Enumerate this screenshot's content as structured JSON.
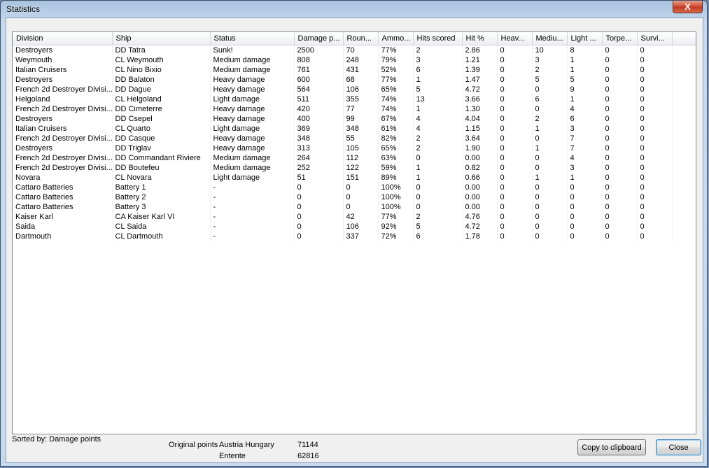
{
  "window": {
    "title": "Statistics",
    "close_glyph": "X"
  },
  "columns": [
    {
      "label": "Division",
      "w": 142
    },
    {
      "label": "Ship",
      "w": 140
    },
    {
      "label": "Status",
      "w": 120
    },
    {
      "label": "Damage p...",
      "w": 70
    },
    {
      "label": "Roun...",
      "w": 50
    },
    {
      "label": "Ammo...",
      "w": 50
    },
    {
      "label": "Hits scored",
      "w": 70
    },
    {
      "label": "Hit %",
      "w": 50
    },
    {
      "label": "Heav...",
      "w": 50
    },
    {
      "label": "Mediu...",
      "w": 50
    },
    {
      "label": "Light ...",
      "w": 50
    },
    {
      "label": "Torpe...",
      "w": 50
    },
    {
      "label": "Survi...",
      "w": 50
    },
    {
      "label": "",
      "w": 36
    }
  ],
  "rows": [
    [
      "Destroyers",
      "DD Tatra",
      "Sunk!",
      "2500",
      "70",
      "77%",
      "2",
      "2.86",
      "0",
      "10",
      "8",
      "0",
      "0"
    ],
    [
      "Weymouth",
      "CL Weymouth",
      "Medium damage",
      "808",
      "248",
      "79%",
      "3",
      "1.21",
      "0",
      "3",
      "1",
      "0",
      "0"
    ],
    [
      "Italian Cruisers",
      "CL Nino Bixio",
      "Medium damage",
      "761",
      "431",
      "52%",
      "6",
      "1.39",
      "0",
      "2",
      "1",
      "0",
      "0"
    ],
    [
      "Destroyers",
      "DD Balaton",
      "Heavy damage",
      "600",
      "68",
      "77%",
      "1",
      "1.47",
      "0",
      "5",
      "5",
      "0",
      "0"
    ],
    [
      "French 2d Destroyer Divisi...",
      "DD Dague",
      "Heavy damage",
      "564",
      "106",
      "65%",
      "5",
      "4.72",
      "0",
      "0",
      "9",
      "0",
      "0"
    ],
    [
      "Helgoland",
      "CL Helgoland",
      "Light damage",
      "511",
      "355",
      "74%",
      "13",
      "3.66",
      "0",
      "6",
      "1",
      "0",
      "0"
    ],
    [
      "French 2d Destroyer Divisi...",
      "DD Cimeterre",
      "Heavy damage",
      "420",
      "77",
      "74%",
      "1",
      "1.30",
      "0",
      "0",
      "4",
      "0",
      "0"
    ],
    [
      "Destroyers",
      "DD Csepel",
      "Heavy damage",
      "400",
      "99",
      "67%",
      "4",
      "4.04",
      "0",
      "2",
      "6",
      "0",
      "0"
    ],
    [
      "Italian Cruisers",
      "CL Quarto",
      "Light damage",
      "369",
      "348",
      "61%",
      "4",
      "1.15",
      "0",
      "1",
      "3",
      "0",
      "0"
    ],
    [
      "French 2d Destroyer Divisi...",
      "DD Casque",
      "Heavy damage",
      "348",
      "55",
      "82%",
      "2",
      "3.64",
      "0",
      "0",
      "7",
      "0",
      "0"
    ],
    [
      "Destroyers",
      "DD Triglav",
      "Heavy damage",
      "313",
      "105",
      "65%",
      "2",
      "1.90",
      "0",
      "1",
      "7",
      "0",
      "0"
    ],
    [
      "French 2d Destroyer Divisi...",
      "DD Commandant Riviere",
      "Medium damage",
      "264",
      "112",
      "63%",
      "0",
      "0.00",
      "0",
      "0",
      "4",
      "0",
      "0"
    ],
    [
      "French 2d Destroyer Divisi...",
      "DD Boutefeu",
      "Medium damage",
      "252",
      "122",
      "59%",
      "1",
      "0.82",
      "0",
      "0",
      "3",
      "0",
      "0"
    ],
    [
      "Novara",
      "CL Novara",
      "Light damage",
      "51",
      "151",
      "89%",
      "1",
      "0.66",
      "0",
      "1",
      "1",
      "0",
      "0"
    ],
    [
      "Cattaro Batteries",
      "Battery 1",
      "-",
      "0",
      "0",
      "100%",
      "0",
      "0.00",
      "0",
      "0",
      "0",
      "0",
      "0"
    ],
    [
      "Cattaro Batteries",
      "Battery 2",
      "-",
      "0",
      "0",
      "100%",
      "0",
      "0.00",
      "0",
      "0",
      "0",
      "0",
      "0"
    ],
    [
      "Cattaro Batteries",
      "Battery 3",
      "-",
      "0",
      "0",
      "100%",
      "0",
      "0.00",
      "0",
      "0",
      "0",
      "0",
      "0"
    ],
    [
      "Kaiser Karl",
      "CA Kaiser Karl VI",
      "-",
      "0",
      "42",
      "77%",
      "2",
      "4.76",
      "0",
      "0",
      "0",
      "0",
      "0"
    ],
    [
      "Saida",
      "CL Saida",
      "-",
      "0",
      "106",
      "92%",
      "5",
      "4.72",
      "0",
      "0",
      "0",
      "0",
      "0"
    ],
    [
      "Dartmouth",
      "CL Dartmouth",
      "-",
      "0",
      "337",
      "72%",
      "6",
      "1.78",
      "0",
      "0",
      "0",
      "0",
      "0"
    ]
  ],
  "footer": {
    "sorted_by": "Sorted by: Damage points",
    "original_points_label": "Original points",
    "side1_name": "Austria Hungary",
    "side1_points": "71144",
    "side2_name": "Entente",
    "side2_points": "62816",
    "copy_label": "Copy to clipboard",
    "close_label": "Close"
  }
}
